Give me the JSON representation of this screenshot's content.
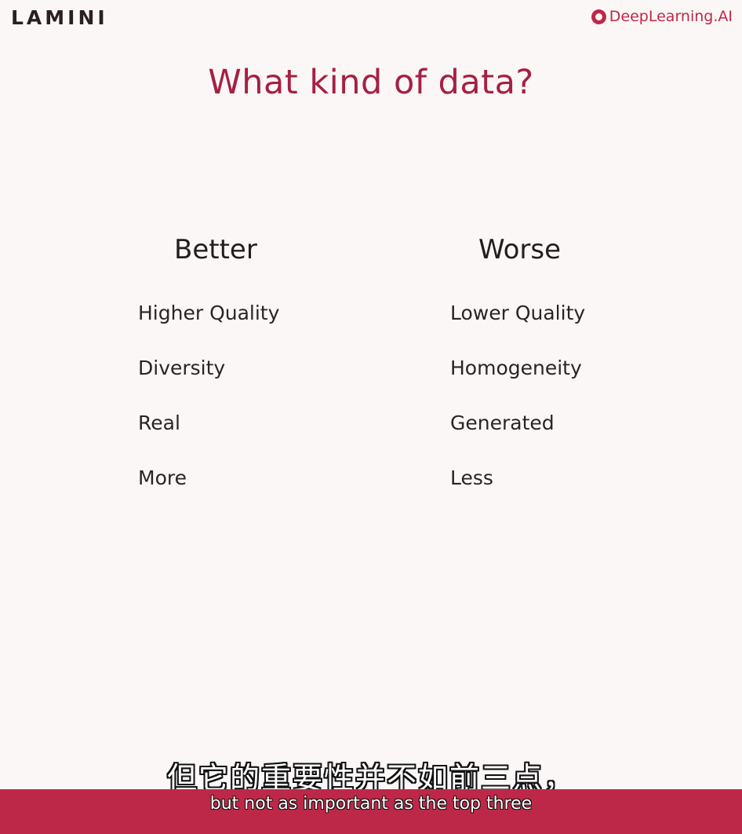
{
  "header": {
    "brand": "LAMINI",
    "partner": "DeepLearning.AI"
  },
  "slide": {
    "title": "What kind of data?",
    "better": {
      "heading": "Better",
      "items": [
        "Higher Quality",
        "Diversity",
        "Real",
        "More"
      ]
    },
    "worse": {
      "heading": "Worse",
      "items": [
        "Lower Quality",
        "Homogeneity",
        "Generated",
        "Less"
      ]
    }
  },
  "captions": {
    "chinese": "但它的重要性并不如前三点，",
    "english": "but not as important as the top three"
  },
  "colors": {
    "title": "#a52042",
    "accent": "#bd2848",
    "background": "#fbf7f6"
  }
}
